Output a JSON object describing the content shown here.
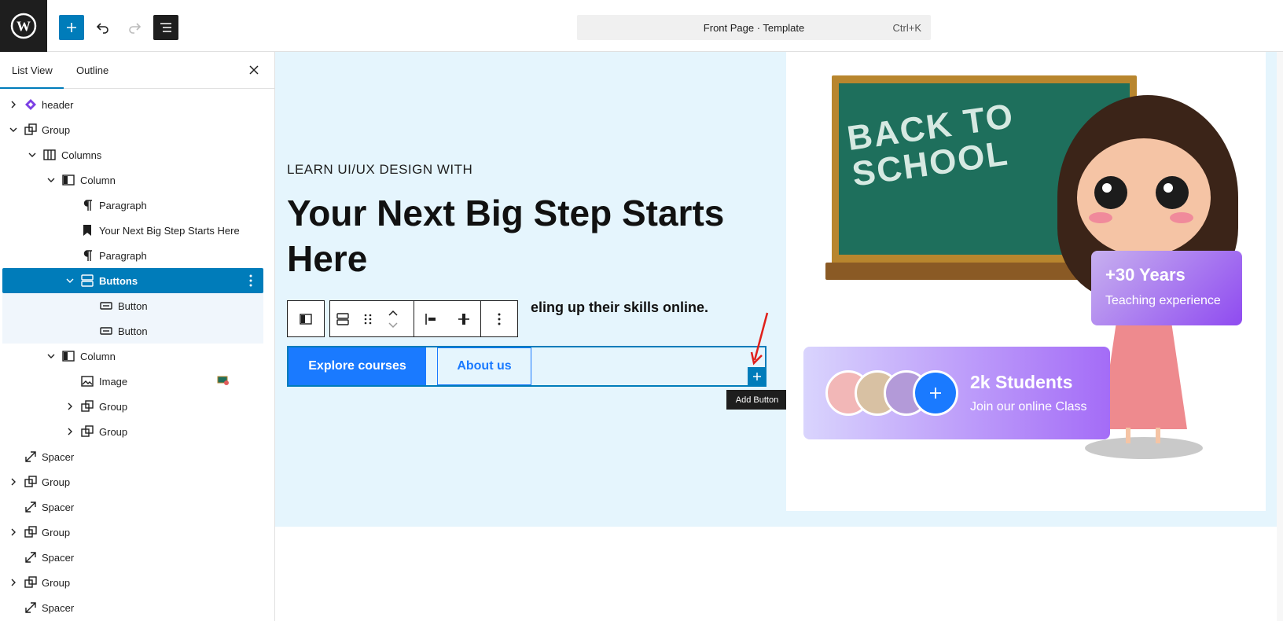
{
  "topbar": {
    "command_title": "Front Page · Template",
    "command_shortcut": "Ctrl+K"
  },
  "sidebar": {
    "tabs": [
      "List View",
      "Outline"
    ],
    "items": [
      {
        "label": "header",
        "icon": "template-part-icon"
      },
      {
        "label": "Group",
        "icon": "group-icon"
      },
      {
        "label": "Columns",
        "icon": "columns-icon"
      },
      {
        "label": "Column",
        "icon": "column-icon"
      },
      {
        "label": "Paragraph",
        "icon": "paragraph-icon"
      },
      {
        "label": "Your Next Big Step Starts Here",
        "icon": "heading-bookmark-icon"
      },
      {
        "label": "Paragraph",
        "icon": "paragraph-icon"
      },
      {
        "label": "Buttons",
        "icon": "buttons-icon"
      },
      {
        "label": "Button",
        "icon": "button-icon"
      },
      {
        "label": "Button",
        "icon": "button-icon"
      },
      {
        "label": "Column",
        "icon": "column-icon"
      },
      {
        "label": "Image",
        "icon": "image-icon"
      },
      {
        "label": "Group",
        "icon": "group-icon"
      },
      {
        "label": "Group",
        "icon": "group-icon"
      },
      {
        "label": "Spacer",
        "icon": "spacer-icon"
      },
      {
        "label": "Group",
        "icon": "group-icon"
      },
      {
        "label": "Spacer",
        "icon": "spacer-icon"
      },
      {
        "label": "Group",
        "icon": "group-icon"
      },
      {
        "label": "Spacer",
        "icon": "spacer-icon"
      },
      {
        "label": "Group",
        "icon": "group-icon"
      },
      {
        "label": "Spacer",
        "icon": "spacer-icon"
      }
    ]
  },
  "canvas": {
    "eyebrow": "LEARN UI/UX DESIGN WITH",
    "heading": "Your Next Big Step Starts Here",
    "subtext": "... ... ... ... ... ... ... ... ... eling up their skills online.",
    "subtext_visible": "eling up their skills online.",
    "buttons": [
      "Explore courses",
      "About us"
    ],
    "tooltip": "Add Button",
    "image": {
      "board_text": "BACK TO SCHOOL",
      "years_title": "+30 Years",
      "years_sub": "Teaching experience",
      "students_title": "2k Students",
      "students_sub": "Join our online Class"
    }
  },
  "colors": {
    "wp_blue": "#007cba",
    "hero_bg": "#e5f5fd",
    "button_blue": "#1a7aff",
    "topbar_dark": "#1e1e1e"
  }
}
